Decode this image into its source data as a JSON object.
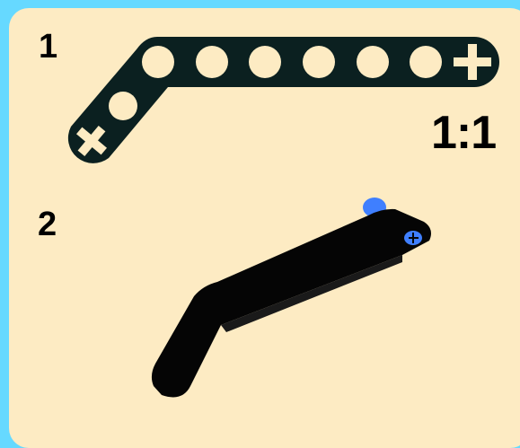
{
  "steps": [
    {
      "number": "1",
      "part_scale": "1:1",
      "part": "bent-liftarm-icon"
    },
    {
      "number": "2",
      "part": "assembled-liftarm-with-blue-pins-icon"
    }
  ],
  "colors": {
    "background": "#66d9ff",
    "panel": "#fdebc3",
    "part": "#0b2020",
    "part_hole": "#fdebc3",
    "pin": "#3f7fff"
  }
}
